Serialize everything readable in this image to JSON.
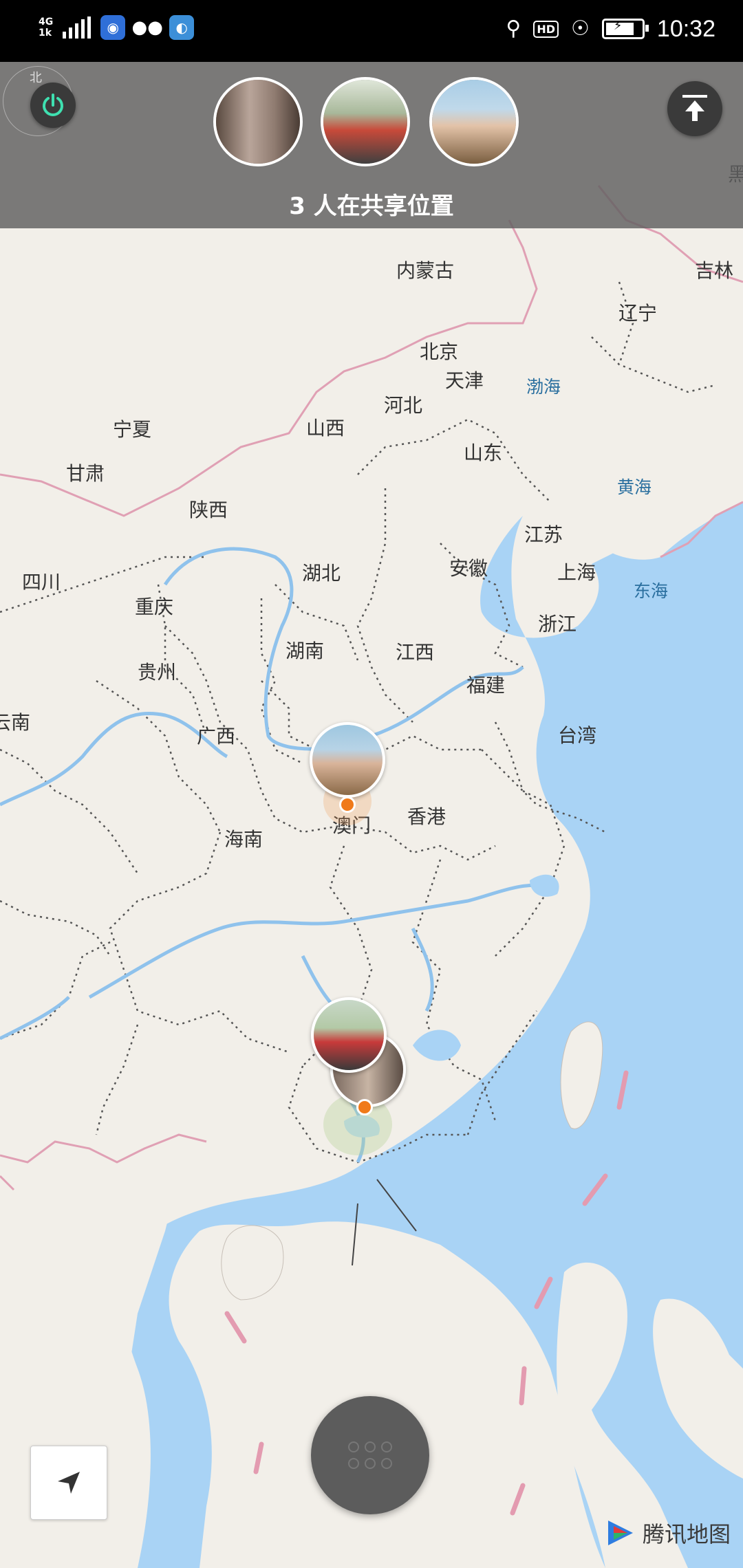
{
  "status_bar": {
    "network": "4G",
    "network_sub": "1k",
    "time": "10:32",
    "hd": "HD",
    "icons": [
      "signal-icon",
      "wifi-hotspot-icon",
      "wechat-icon",
      "app-icon",
      "location-icon",
      "hd-icon",
      "eye-icon",
      "battery-icon"
    ]
  },
  "header": {
    "share_text": "3 人在共享位置",
    "compass_label": "北",
    "avatars": [
      {
        "name": "avatar-1",
        "color": "#6b5a50"
      },
      {
        "name": "avatar-2",
        "color": "#8a9a7a"
      },
      {
        "name": "avatar-3",
        "color": "#7aa0b8"
      }
    ]
  },
  "map": {
    "labels": [
      {
        "text": "内蒙古",
        "kind": "province"
      },
      {
        "text": "吉林",
        "kind": "province"
      },
      {
        "text": "辽宁",
        "kind": "province"
      },
      {
        "text": "北京",
        "kind": "province"
      },
      {
        "text": "天津",
        "kind": "province"
      },
      {
        "text": "渤海",
        "kind": "sea"
      },
      {
        "text": "河北",
        "kind": "province"
      },
      {
        "text": "宁夏",
        "kind": "province"
      },
      {
        "text": "山西",
        "kind": "province"
      },
      {
        "text": "山东",
        "kind": "province"
      },
      {
        "text": "甘肃",
        "kind": "province"
      },
      {
        "text": "黄海",
        "kind": "sea"
      },
      {
        "text": "陕西",
        "kind": "province"
      },
      {
        "text": "江苏",
        "kind": "province"
      },
      {
        "text": "湖北",
        "kind": "province"
      },
      {
        "text": "安徽",
        "kind": "province"
      },
      {
        "text": "上海",
        "kind": "province"
      },
      {
        "text": "四川",
        "kind": "province"
      },
      {
        "text": "东海",
        "kind": "sea"
      },
      {
        "text": "重庆",
        "kind": "province"
      },
      {
        "text": "浙江",
        "kind": "province"
      },
      {
        "text": "湖南",
        "kind": "province"
      },
      {
        "text": "江西",
        "kind": "province"
      },
      {
        "text": "贵州",
        "kind": "province"
      },
      {
        "text": "福建",
        "kind": "province"
      },
      {
        "text": "云南",
        "kind": "province"
      },
      {
        "text": "广西",
        "kind": "province"
      },
      {
        "text": "台湾",
        "kind": "province"
      },
      {
        "text": "澳门",
        "kind": "province"
      },
      {
        "text": "香港",
        "kind": "province"
      },
      {
        "text": "海南",
        "kind": "province"
      },
      {
        "text": "黑",
        "kind": "province"
      }
    ],
    "colors": {
      "land": "#f2efe9",
      "water": "#a9d3f5",
      "border": "#e8a6b6"
    }
  },
  "controls": {
    "locate_icon": "navigation-arrow-icon",
    "menu_icon": "grid-icon",
    "brand": "腾讯地图"
  }
}
